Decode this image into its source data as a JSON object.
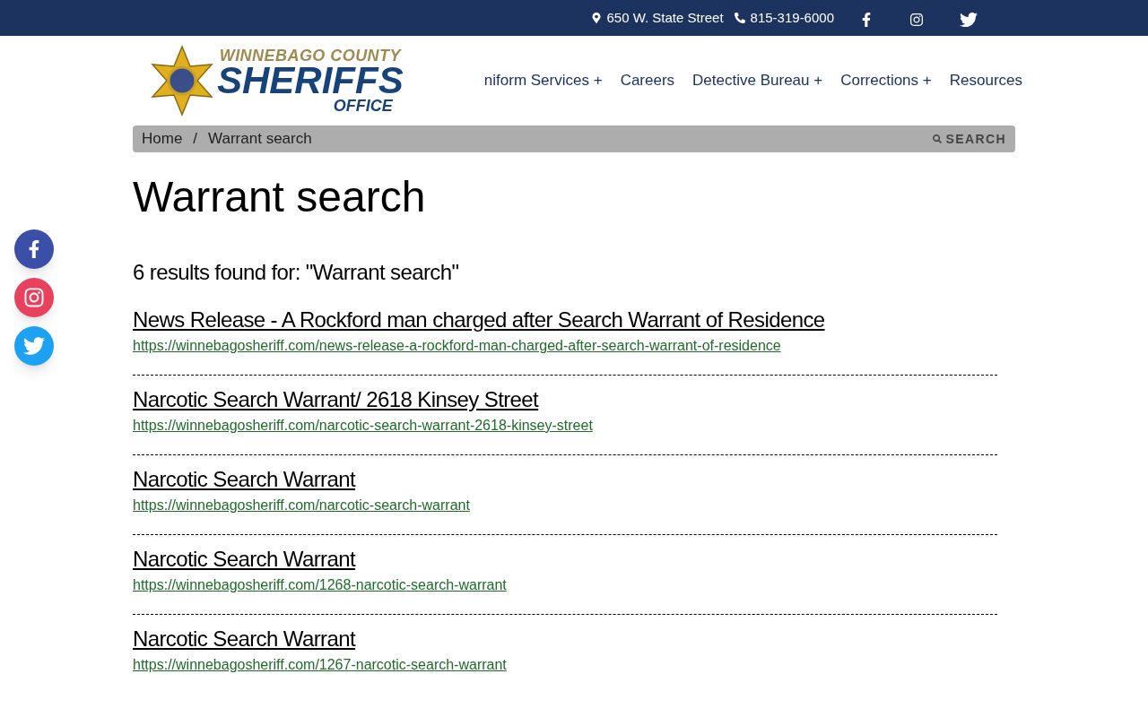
{
  "top_bar": {
    "address": "650 W. State Street",
    "phone": "815-319-6000"
  },
  "logo": {
    "line_1": "WINNEBAGO COUNTY",
    "line_2": "SHERIFFS",
    "line_3": "OFFICE"
  },
  "nav": [
    {
      "label": "niform Services +"
    },
    {
      "label": "Careers"
    },
    {
      "label": "Detective Bureau +"
    },
    {
      "label": "Corrections +"
    },
    {
      "label": "Resources"
    }
  ],
  "breadcrumb": [
    {
      "label": "Home"
    },
    {
      "label": "Warrant search"
    }
  ],
  "breadcrumb_separator": "/",
  "search_button": "SEARCH",
  "page_title": "Warrant search",
  "results_summary": "6 results found for: \"Warrant search\"",
  "results": [
    {
      "title": "News Release - A Rockford man charged after Search Warrant of Residence",
      "url": "https://winnebagosheriff.com/news-release-a-rockford-man-charged-after-search-warrant-of-residence"
    },
    {
      "title": "Narcotic Search Warrant/ 2618 Kinsey Street",
      "url": "https://winnebagosheriff.com/narcotic-search-warrant-2618-kinsey-street"
    },
    {
      "title": "Narcotic Search Warrant",
      "url": "https://winnebagosheriff.com/narcotic-search-warrant"
    },
    {
      "title": "Narcotic Search Warrant",
      "url": "https://winnebagosheriff.com/1268-narcotic-search-warrant"
    },
    {
      "title": "Narcotic Search Warrant",
      "url": "https://winnebagosheriff.com/1267-narcotic-search-warrant"
    }
  ]
}
